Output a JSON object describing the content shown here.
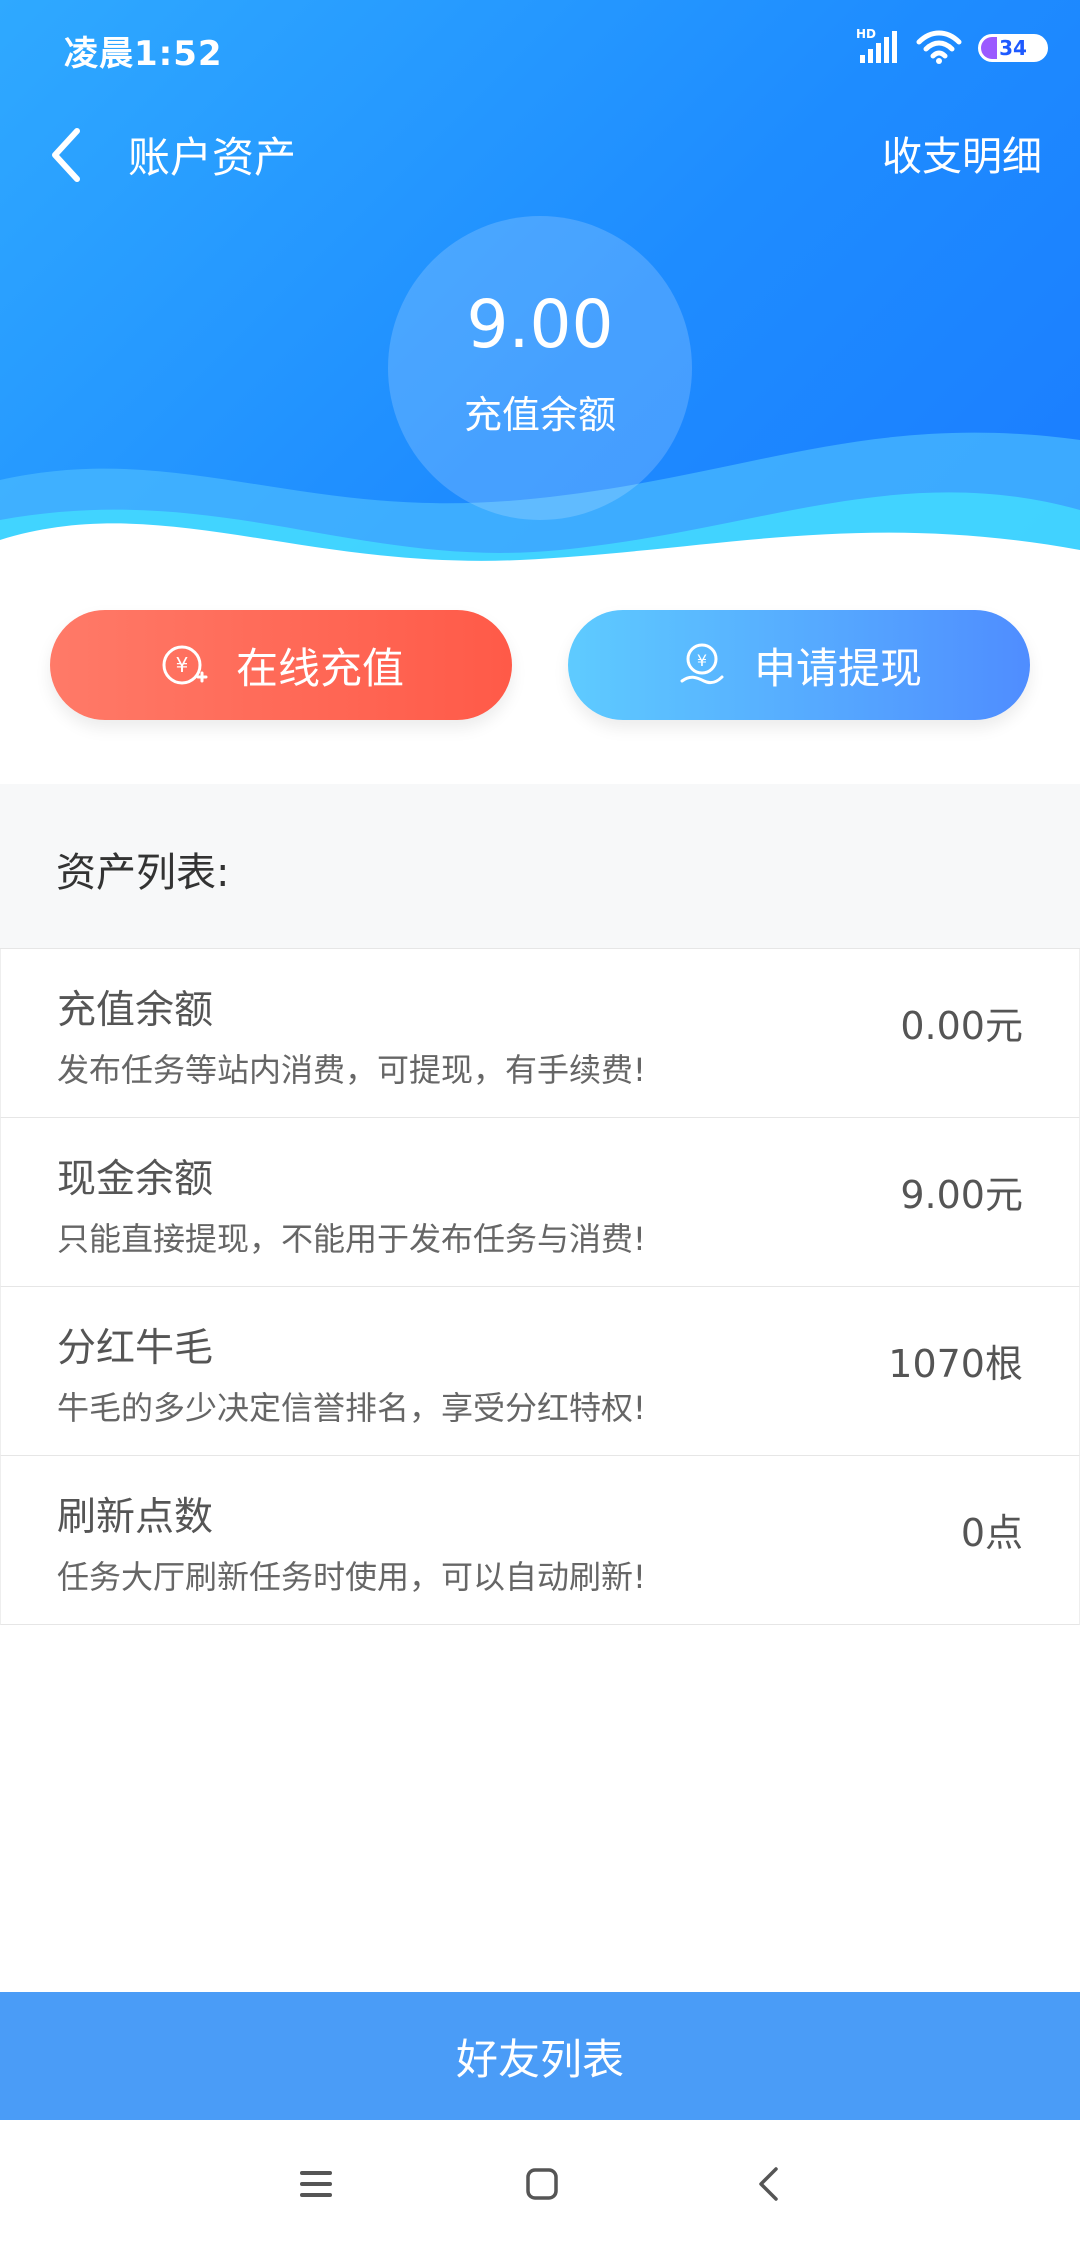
{
  "status_bar": {
    "time": "凌晨1:52",
    "signal_label": "HD",
    "battery_level": "34"
  },
  "nav": {
    "title": "账户资产",
    "detail_link": "收支明细"
  },
  "balance": {
    "amount": "9.00",
    "label": "充值余额"
  },
  "actions": {
    "recharge": "在线充值",
    "withdraw": "申请提现"
  },
  "list": {
    "header": "资产列表:",
    "items": [
      {
        "name": "充值余额",
        "desc": "发布任务等站内消费，可提现，有手续费!",
        "value": "0.00元"
      },
      {
        "name": "现金余额",
        "desc": "只能直接提现，不能用于发布任务与消费!",
        "value": "9.00元"
      },
      {
        "name": "分红牛毛",
        "desc": "牛毛的多少决定信誉排名，享受分红特权!",
        "value": "1070根"
      },
      {
        "name": "刷新点数",
        "desc": "任务大厅刷新任务时使用，可以自动刷新!",
        "value": "0点"
      }
    ]
  },
  "footer": {
    "friends_button": "好友列表"
  },
  "colors": {
    "header_gradient_start": "#2fa9ff",
    "header_gradient_end": "#1a7bff",
    "recharge_button": "#ff5a48",
    "withdraw_button": "#4f8dff",
    "friends_bar": "#4a9cf7"
  }
}
